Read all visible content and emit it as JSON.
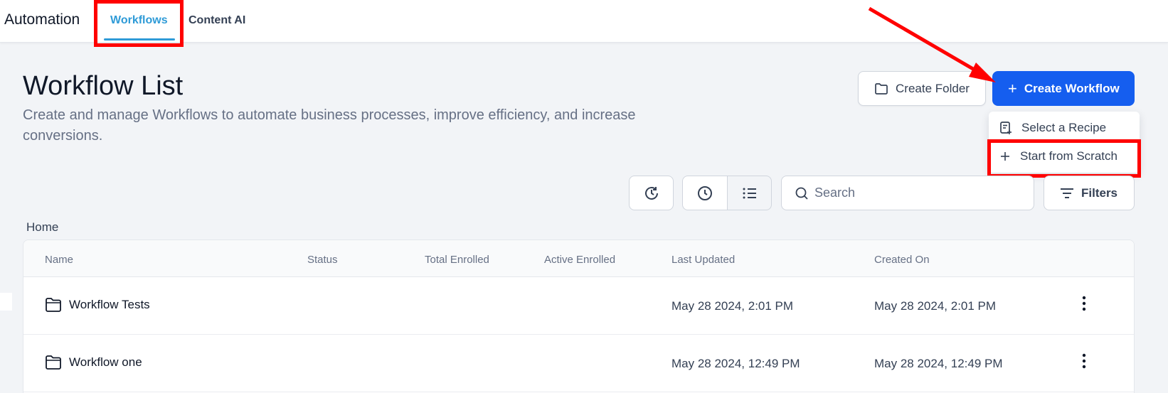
{
  "app": {
    "title": "Automation"
  },
  "tabs": [
    {
      "label": "Workflows",
      "active": true
    },
    {
      "label": "Content AI",
      "active": false
    }
  ],
  "header": {
    "title": "Workflow List",
    "description": "Create and manage Workflows to automate business processes, improve efficiency, and increase conversions."
  },
  "actions": {
    "create_folder": "Create Folder",
    "create_workflow": "Create Workflow"
  },
  "dropdown": {
    "items": [
      {
        "label": "Select a Recipe",
        "icon": "recipe-icon"
      },
      {
        "label": "Start from Scratch",
        "icon": "plus-icon"
      }
    ]
  },
  "toolbar": {
    "search_placeholder": "Search",
    "filters_label": "Filters"
  },
  "breadcrumb": "Home",
  "table": {
    "columns": [
      "Name",
      "Status",
      "Total Enrolled",
      "Active Enrolled",
      "Last Updated",
      "Created On"
    ],
    "rows": [
      {
        "name": "Workflow Tests",
        "status": "",
        "total_enrolled": "",
        "active_enrolled": "",
        "last_updated": "May 28 2024, 2:01 PM",
        "created_on": "May 28 2024, 2:01 PM"
      },
      {
        "name": "Workflow one",
        "status": "",
        "total_enrolled": "",
        "active_enrolled": "",
        "last_updated": "May 28 2024, 12:49 PM",
        "created_on": "May 28 2024, 12:49 PM"
      }
    ]
  },
  "colors": {
    "accent": "#155eef",
    "tab_active": "#2f9bd7",
    "annotation": "#ff0000"
  }
}
